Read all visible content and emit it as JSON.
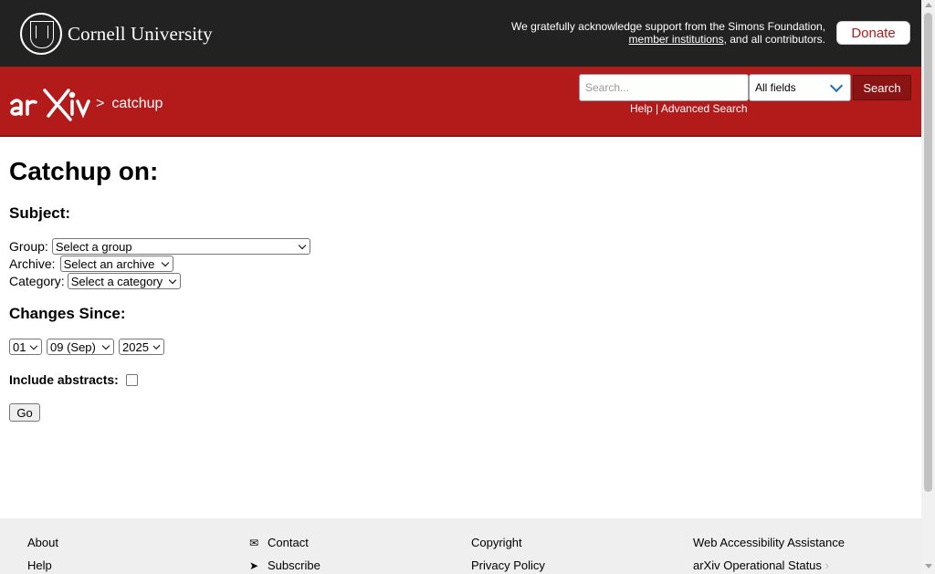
{
  "header": {
    "cornell_text": "Cornell University",
    "ack_line1": "We gratefully acknowledge support from the Simons Foundation,",
    "ack_link": "member institutions",
    "ack_line2_rest": ", and all contributors.",
    "donate_label": "Donate"
  },
  "nav": {
    "breadcrumb_sep": ">",
    "breadcrumb_page": "catchup",
    "search_placeholder": "Search...",
    "field_selected": "All fields",
    "search_button": "Search",
    "help_link": "Help",
    "help_sep": "|",
    "advanced_link": "Advanced Search"
  },
  "main": {
    "title": "Catchup on:",
    "subject_heading": "Subject:",
    "group_label": "Group:",
    "group_value": "Select a group",
    "archive_label": "Archive:",
    "archive_value": "Select an archive",
    "category_label": "Category:",
    "category_value": "Select a category",
    "changes_heading": "Changes Since:",
    "day_value": "01",
    "month_value": "09 (Sep)",
    "year_value": "2025",
    "abstracts_label": "Include abstracts:",
    "go_button": "Go"
  },
  "footer": {
    "col1": [
      "About",
      "Help"
    ],
    "col2": [
      "Contact",
      "Subscribe"
    ],
    "col3": [
      "Copyright",
      "Privacy Policy"
    ],
    "col4": [
      "Web Accessibility Assistance",
      "arXiv Operational Status"
    ]
  },
  "colors": {
    "topbar": "#222222",
    "brand_red": "#b31b1b",
    "footer_bg": "#efefef"
  },
  "icons": {
    "contact": "envelope-icon",
    "subscribe": "paper-plane-icon",
    "status": "chevron-right-icon"
  }
}
